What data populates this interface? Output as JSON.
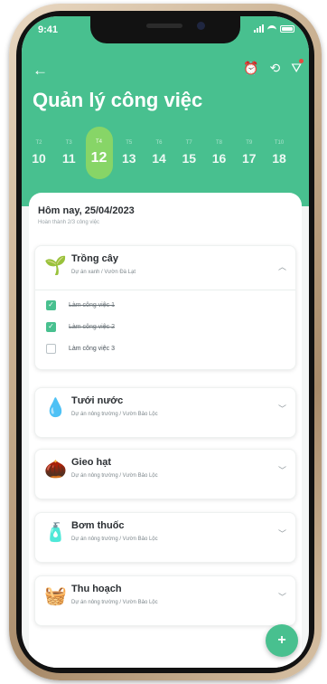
{
  "status": {
    "time": "9:41"
  },
  "header": {
    "title": "Quản lý công việc",
    "back_icon": "arrow-left-icon",
    "actions": [
      "alarm-clock-icon",
      "history-icon",
      "filter-icon"
    ],
    "accent": "#48c08f",
    "selected_date_color": "#87d567"
  },
  "dates": [
    {
      "weekday": "T2",
      "day": "10"
    },
    {
      "weekday": "T3",
      "day": "11"
    },
    {
      "weekday": "T4",
      "day": "12",
      "selected": true
    },
    {
      "weekday": "T5",
      "day": "13"
    },
    {
      "weekday": "T6",
      "day": "14"
    },
    {
      "weekday": "T7",
      "day": "15"
    },
    {
      "weekday": "T8",
      "day": "16"
    },
    {
      "weekday": "T9",
      "day": "17"
    },
    {
      "weekday": "T10",
      "day": "18"
    }
  ],
  "today": {
    "label": "Hôm nay, 25/04/2023",
    "subtitle": "Hoàn thành 2/3 công việc"
  },
  "projects": [
    {
      "icon": "sprout-icon",
      "glyph": "🌱",
      "title": "Trồng cây",
      "subtitle": "Dự án xanh  /  Vườn Đà Lạt",
      "expanded": true,
      "tasks": [
        {
          "label": "Làm công việc 1",
          "done": true
        },
        {
          "label": "Làm công việc 2",
          "done": true
        },
        {
          "label": "Làm công việc 3",
          "done": false
        }
      ]
    },
    {
      "icon": "water-drop-icon",
      "glyph": "💧",
      "title": "Tưới nước",
      "subtitle": "Dự án nông trường  /  Vườn Bảo Lộc",
      "expanded": false
    },
    {
      "icon": "seed-icon",
      "glyph": "🌰",
      "title": "Gieo hạt",
      "subtitle": "Dự án nông trường  /  Vườn Bảo Lộc",
      "expanded": false
    },
    {
      "icon": "spray-bottle-icon",
      "glyph": "🧴",
      "title": "Bơm thuốc",
      "subtitle": "Dự án nông trường  /  Vườn Bảo Lộc",
      "expanded": false
    },
    {
      "icon": "harvest-basket-icon",
      "glyph": "🧺",
      "title": "Thu hoạch",
      "subtitle": "Dự án nông trường  /  Vườn Bảo Lộc",
      "expanded": false
    }
  ],
  "fab": {
    "icon": "add-icon",
    "glyph": "+"
  }
}
